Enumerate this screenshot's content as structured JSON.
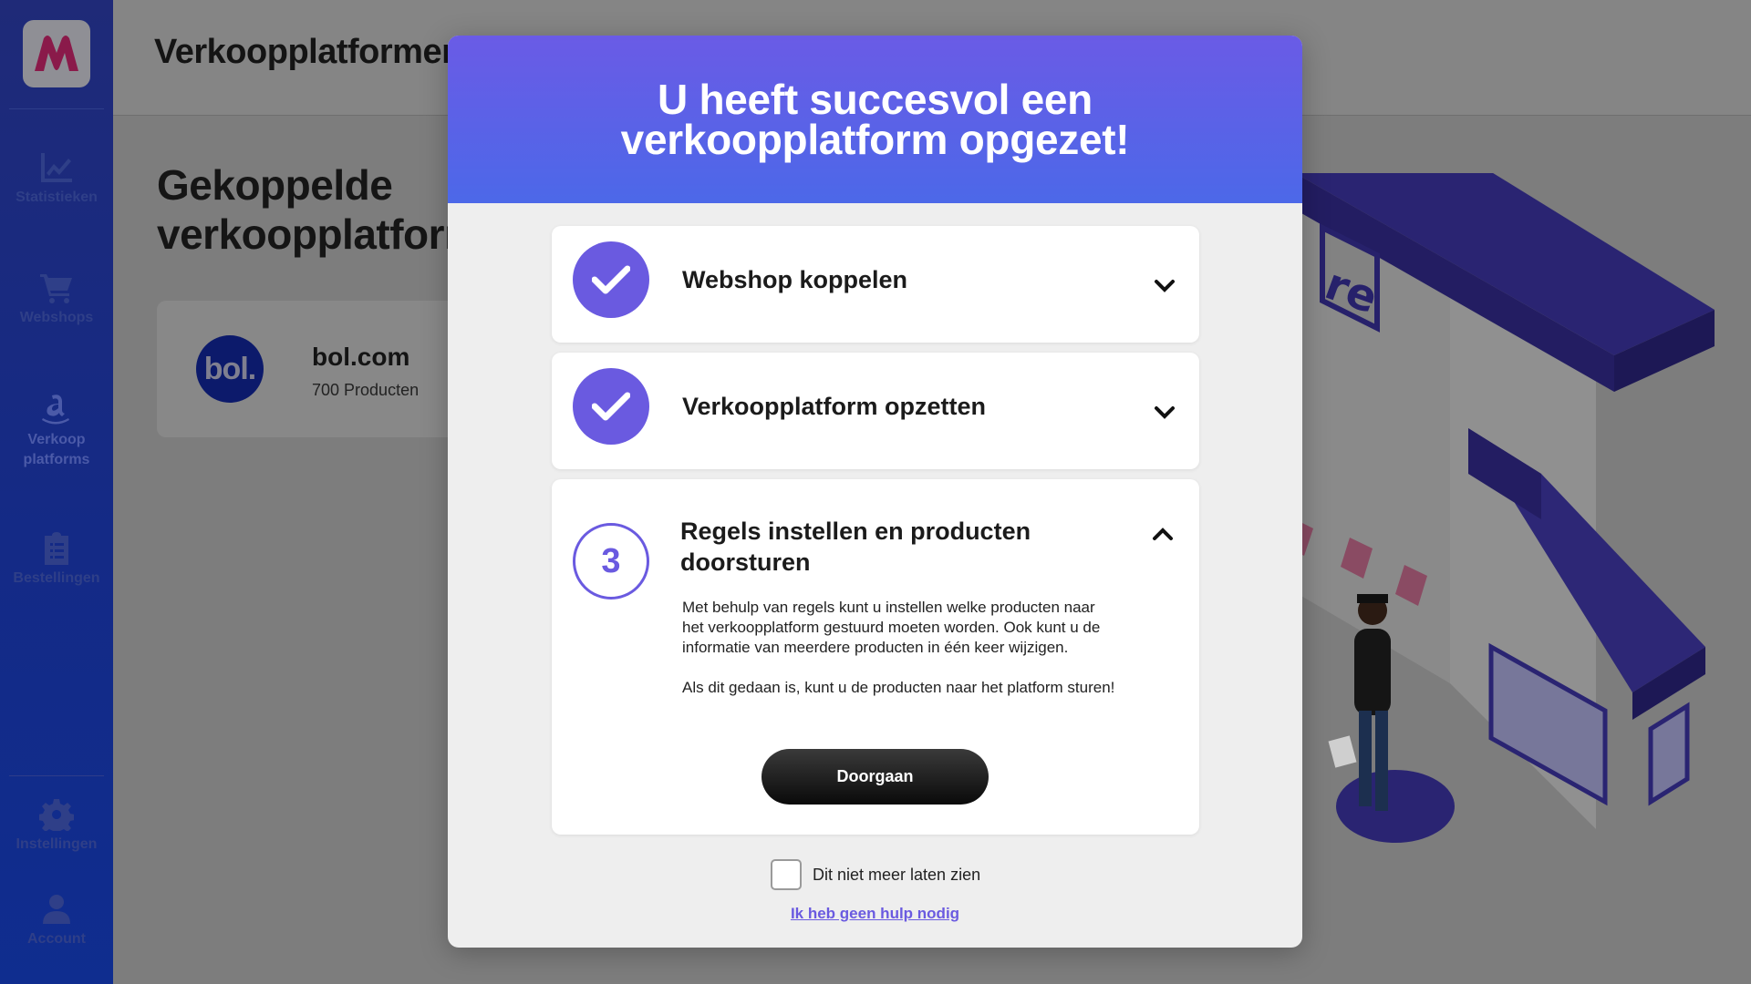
{
  "sidebar": {
    "items": [
      {
        "label": "Statistieken",
        "icon": "chart-icon"
      },
      {
        "label": "Webshops",
        "icon": "cart-icon"
      },
      {
        "label": "Verkoop platforms",
        "icon": "amazon-icon"
      },
      {
        "label": "Bestellingen",
        "icon": "clipboard-icon"
      },
      {
        "label": "Instellingen",
        "icon": "gear-icon"
      },
      {
        "label": "Account",
        "icon": "user-icon"
      }
    ]
  },
  "header": {
    "title": "Verkoopplatformen"
  },
  "main": {
    "heading": "Gekoppelde verkoopplatformen",
    "platform": {
      "logo_text": "bol.",
      "name": "bol.com",
      "products": "700 Producten"
    }
  },
  "modal": {
    "title": "U heeft succesvol een verkoopplatform opgezet!",
    "steps": [
      {
        "title": "Webshop koppelen",
        "status": "done"
      },
      {
        "title": "Verkoopplatform opzetten",
        "status": "done"
      },
      {
        "number": "3",
        "title": "Regels instellen en producten doorsturen",
        "status": "active",
        "description_1": "Met behulp van regels kunt u instellen welke producten naar het verkoopplatform gestuurd moeten worden. Ook kunt u de informatie van meerdere producten in één keer wijzigen.",
        "description_2": "Als dit gedaan is, kunt u de producten naar het platform sturen!",
        "button_label": "Doorgaan"
      }
    ],
    "checkbox_label": "Dit niet meer laten zien",
    "help_link": "Ik heb geen hulp nodig"
  },
  "colors": {
    "accent": "#6a5ae0",
    "header_gradient_start": "#6a5be6",
    "header_gradient_end": "#4c68e8",
    "sidebar": "#142a86"
  }
}
